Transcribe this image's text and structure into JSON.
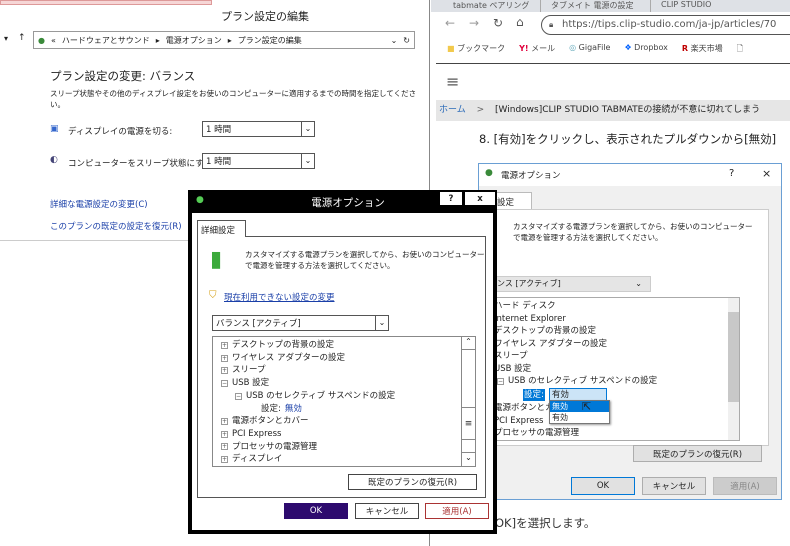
{
  "explorer": {
    "title": "プラン設定の編集",
    "breadcrumb": [
      "«",
      "ハードウェアとサウンド",
      "電源オプション",
      "プラン設定の編集"
    ],
    "heading": "プラン設定の変更: バランス",
    "description": "スリープ状態やその他のディスプレイ設定をお使いのコンピューターに適用するまでの時間を指定してください。",
    "settings": [
      {
        "label": "ディスプレイの電源を切る:",
        "value": "1 時間"
      },
      {
        "label": "コンピューターをスリープ状態にする:",
        "value": "1 時間"
      }
    ],
    "links": [
      "詳細な電源設定の変更(C)",
      "このプランの既定の設定を復元(R)"
    ]
  },
  "browser": {
    "tabs": [
      "tabmate ペアリング",
      "タブメイト 電源の設定",
      "CLIP STUDIO"
    ],
    "url": "https://tips.clip-studio.com/ja-jp/articles/70",
    "bookmarks": [
      "ブックマーク",
      "メール",
      "GigaFile",
      "Dropbox",
      "楽天市場"
    ],
    "breadcrumb_home": "ホーム",
    "breadcrumb_sep": ">",
    "breadcrumb_title": "[Windows]CLIP STUDIO TABMATEの接続が不意に切れてしまう",
    "step_text": "8. [有効]をクリックし、表示されたプルダウンから[無効]",
    "after_text": "OK]を選択します。"
  },
  "dialog": {
    "title": "電源オプション",
    "help": "?",
    "close": "x",
    "tab": "詳細設定",
    "intro": [
      "カスタマイズする電源プランを選択してから、お使いのコンピューター",
      "で電源を管理する方法を選択してください。"
    ],
    "admin_link": "現在利用できない設定の変更",
    "plan": "バランス [アクティブ]",
    "tree": [
      {
        "sign": "+",
        "label": "デスクトップの背景の設定",
        "level": 0
      },
      {
        "sign": "+",
        "label": "ワイヤレス アダプターの設定",
        "level": 0
      },
      {
        "sign": "+",
        "label": "スリープ",
        "level": 0
      },
      {
        "sign": "−",
        "label": "USB 設定",
        "level": 0
      },
      {
        "sign": "−",
        "label": "USB のセレクティブ サスペンドの設定",
        "level": 1
      },
      {
        "sign": "+",
        "label": "電源ボタンとカバー",
        "level": 0
      },
      {
        "sign": "+",
        "label": "PCI Express",
        "level": 0
      },
      {
        "sign": "+",
        "label": "プロセッサの電源管理",
        "level": 0
      },
      {
        "sign": "+",
        "label": "ディスプレイ",
        "level": 0
      }
    ],
    "setting_label": "設定:",
    "setting_value": "無効",
    "restore": "既定のプランの復元(R)",
    "ok": "OK",
    "cancel": "キャンセル",
    "apply": "適用(A)"
  },
  "ref_dialog": {
    "title": "電源オプション",
    "help": "?",
    "close": "×",
    "tab": "詳細設定",
    "intro": [
      "カスタマイズする電源プランを選択してから、お使いのコンピューター",
      "で電源を管理する方法を選択してください。"
    ],
    "plan": "バランス [アクティブ]",
    "tree": [
      "ハード ディスク",
      "Internet Explorer",
      "デスクトップの背景の設定",
      "ワイヤレス アダプターの設定",
      "スリープ",
      "USB 設定",
      "USB のセレクティブ サスペンドの設定",
      "電源ボタンとカバー",
      "PCI Express",
      "プロセッサの電源管理"
    ],
    "setting_label": "設定:",
    "setting_value": "有効",
    "options": [
      "無効",
      "有効"
    ],
    "restore": "既定のプランの復元(R)",
    "ok": "OK",
    "cancel": "キャンセル",
    "apply": "適用(A)"
  }
}
